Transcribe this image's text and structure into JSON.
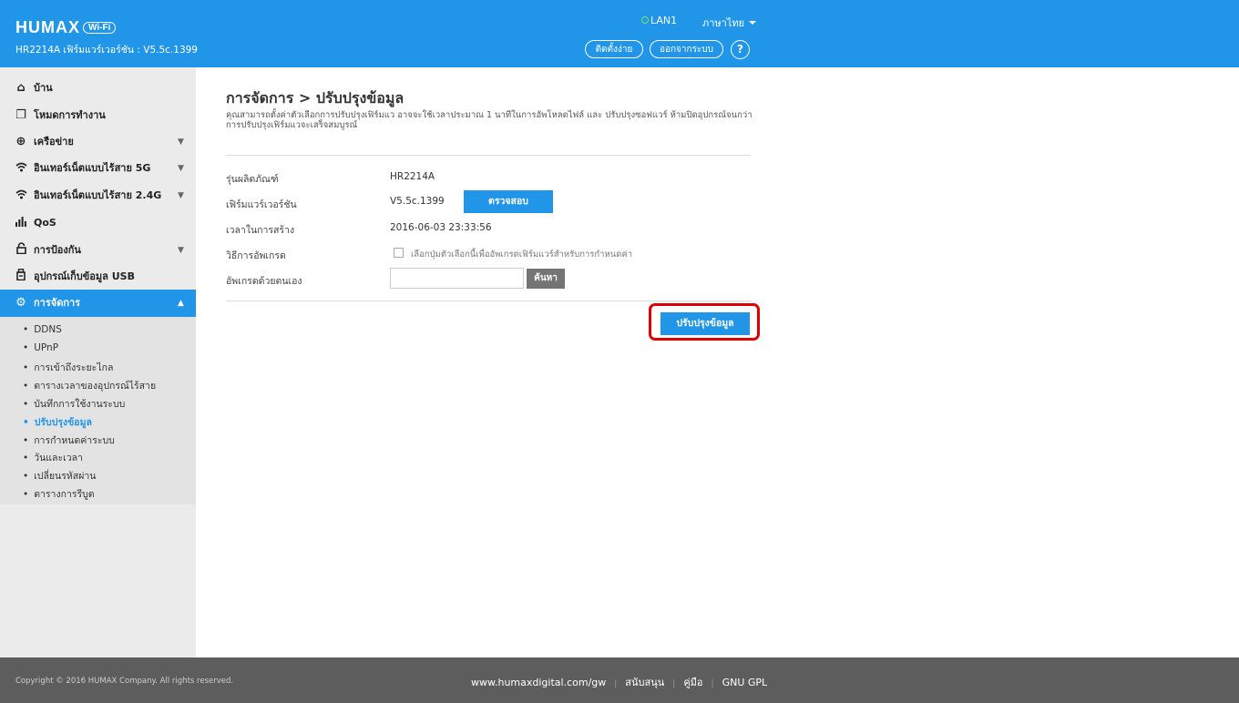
{
  "header": {
    "logo": "HUMAX",
    "logo_badge": "Wi-Fi",
    "model_version": "HR2214A เฟิร์มแวร์เวอร์ชัน : V5.5c.1399",
    "lan_status": "LAN1",
    "language": "ภาษาไทย",
    "easy_setup": "ติดตั้งง่าย",
    "logout": "ออกจากระบบ",
    "help": "?"
  },
  "sidebar": {
    "items": [
      {
        "label": "บ้าน",
        "icon": "home-icon"
      },
      {
        "label": "โหมดการทำงาน",
        "icon": "mode-icon"
      },
      {
        "label": "เครือข่าย",
        "icon": "globe-icon"
      },
      {
        "label": "อินเทอร์เน็ตแบบไร้สาย 5G",
        "icon": "wifi-icon"
      },
      {
        "label": "อินเทอร์เน็ตแบบไร้สาย 2.4G",
        "icon": "wifi-icon"
      },
      {
        "label": "QoS",
        "icon": "bars-icon"
      },
      {
        "label": "การป้องกัน",
        "icon": "lock-icon"
      },
      {
        "label": "อุปกรณ์เก็บข้อมูล USB",
        "icon": "usb-icon"
      },
      {
        "label": "การจัดการ",
        "icon": "gear-icon"
      }
    ],
    "submenu": [
      "DDNS",
      "UPnP",
      "การเข้าถึงระยะไกล",
      "ตารางเวลาของอุปกรณ์ไร้สาย",
      "บันทึกการใช้งานระบบ",
      "ปรับปรุงข้อมูล",
      "การกำหนดค่าระบบ",
      "วันและเวลา",
      "เปลี่ยนรหัสผ่าน",
      "ตารางการรีบูต"
    ],
    "active_sub_index": 5
  },
  "main": {
    "title": "การจัดการ > ปรับปรุงข้อมูล",
    "description": "คุณสามารถตั้งค่าตัวเลือกการปรับปรุงเฟิร์มแว อาจจะใช้เวลาประมาณ 1 นาทีในการอัพโหลดไฟล์ และ ปรับปรุงซอฟแวร์ ห้ามปิดอุปกรณ์จนกว่าการปรับปรุงเฟิร์มแวจะเสร็จสมบูรณ์",
    "model_label": "รุ่นผลิตภัณฑ์",
    "model_value": "HR2214A",
    "firmware_label": "เฟิร์มแวร์เวอร์ชัน",
    "firmware_value": "V5.5c.1399",
    "check_button": "ตรวจสอบ",
    "build_time_label": "เวลาในการสร้าง",
    "build_time_value": "2016-06-03 23:33:56",
    "upgrade_method_label": "วิธีการอัพเกรด",
    "upgrade_checkbox_label": "เลือกปุ่มตัวเลือกนี้เพื่ออัพเกรดเฟิร์มแวร์สำหรับการกำหนดค่า",
    "manual_upgrade_label": "อัพเกรดด้วยตนเอง",
    "file_input_value": "",
    "browse_button": "ค้นหา",
    "update_button": "ปรับปรุงข้อมูล"
  },
  "footer": {
    "copyright": "Copyright © 2016 HUMAX Company. All rights reserved.",
    "website": "www.humaxdigital.com/gw",
    "support": "สนับสนุน",
    "manual": "คู่มือ",
    "gpl": "GNU GPL"
  },
  "colors": {
    "brand_blue": "#2196e8",
    "highlight_red": "#e00000",
    "footer_gray": "#5d5d5d",
    "sidebar_gray": "#ebebeb"
  }
}
